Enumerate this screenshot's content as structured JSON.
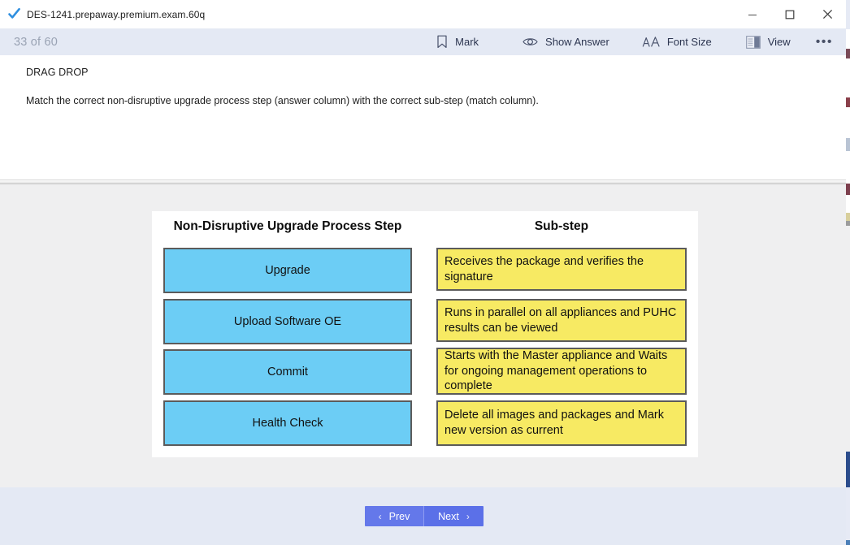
{
  "window": {
    "title": "DES-1241.prepaway.premium.exam.60q",
    "app_icon": "check-icon",
    "minimize_label": "—",
    "maximize_label": "❐",
    "close_label": "✕"
  },
  "toolbar": {
    "counter": "33 of 60",
    "items": [
      {
        "label": "Mark",
        "icon": "bookmark-icon"
      },
      {
        "label": "Show Answer",
        "icon": "eye-icon"
      },
      {
        "label": "Font Size",
        "icon": "font-size-icon"
      },
      {
        "label": "View",
        "icon": "view-layout-icon"
      }
    ],
    "more_label": "•••"
  },
  "question": {
    "type_tag": "DRAG DROP",
    "prompt": "Match the correct non-disruptive upgrade process step (answer column) with the correct sub-step (match column)."
  },
  "exhibit": {
    "left_header": "Non-Disruptive Upgrade Process Step",
    "right_header": "Sub-step",
    "answer_items": [
      "Upgrade",
      "Upload Software OE",
      "Commit",
      "Health Check"
    ],
    "match_items": [
      "Receives the package and verifies the signature",
      "Runs in parallel on all appliances and PUHC results can be viewed",
      "Starts with the Master appliance and Waits for ongoing management operations to complete",
      "Delete all images and packages and Mark new version as current"
    ],
    "answer_color": "#6ccdf5",
    "match_color": "#f7ea63",
    "border_color": "#5b5b5b"
  },
  "footer": {
    "prev_label": "Prev",
    "next_label": "Next",
    "prev_chevron": "‹",
    "next_chevron": "›",
    "button_color": "#5b70e8"
  }
}
